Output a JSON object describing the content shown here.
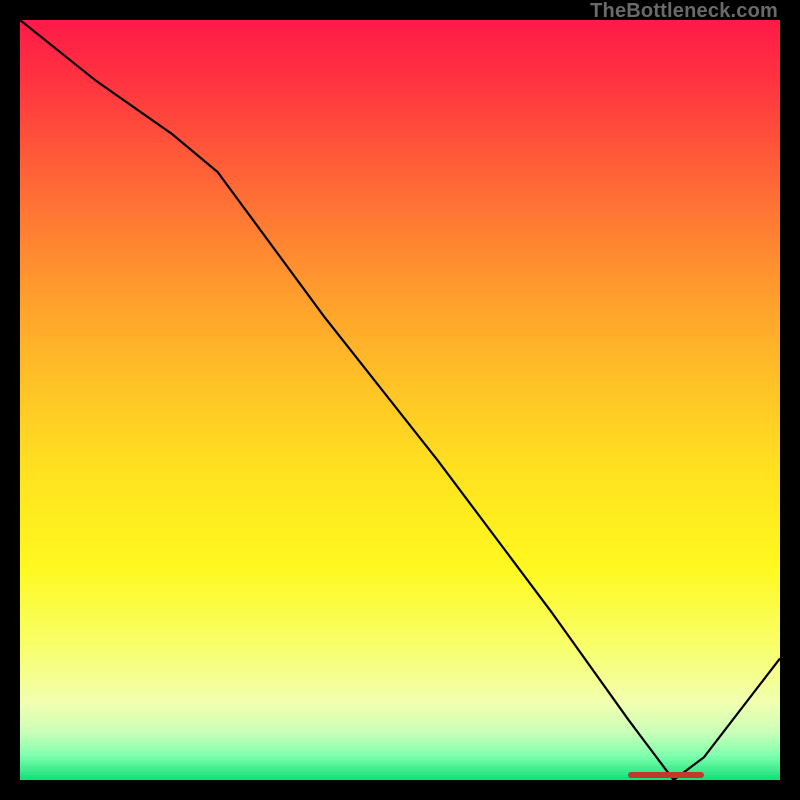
{
  "attribution": "TheBottleneck.com",
  "colors": {
    "curve_stroke": "#000000",
    "marker": "#c0392b",
    "frame_bg": "#000000"
  },
  "chart_data": {
    "type": "line",
    "title": "",
    "xlabel": "",
    "ylabel": "",
    "xlim": [
      0,
      100
    ],
    "ylim": [
      0,
      100
    ],
    "x": [
      0,
      10,
      20,
      26,
      40,
      55,
      70,
      80,
      86,
      90,
      100
    ],
    "values": [
      100,
      92,
      85,
      80,
      61,
      42,
      22,
      8,
      0,
      3,
      16
    ],
    "optimum_range_x": [
      80,
      90
    ],
    "gradient": [
      {
        "y_pct": 0,
        "color": "#ff1a47"
      },
      {
        "y_pct": 10,
        "color": "#ff3b3e"
      },
      {
        "y_pct": 22,
        "color": "#ff6a36"
      },
      {
        "y_pct": 35,
        "color": "#ff9a2e"
      },
      {
        "y_pct": 48,
        "color": "#ffc326"
      },
      {
        "y_pct": 60,
        "color": "#ffe31f"
      },
      {
        "y_pct": 72,
        "color": "#fff81f"
      },
      {
        "y_pct": 82,
        "color": "#f8ff66"
      },
      {
        "y_pct": 90,
        "color": "#f2ffb0"
      },
      {
        "y_pct": 94,
        "color": "#c8ffb8"
      },
      {
        "y_pct": 97,
        "color": "#7dffad"
      },
      {
        "y_pct": 100,
        "color": "#18e07a"
      }
    ]
  }
}
